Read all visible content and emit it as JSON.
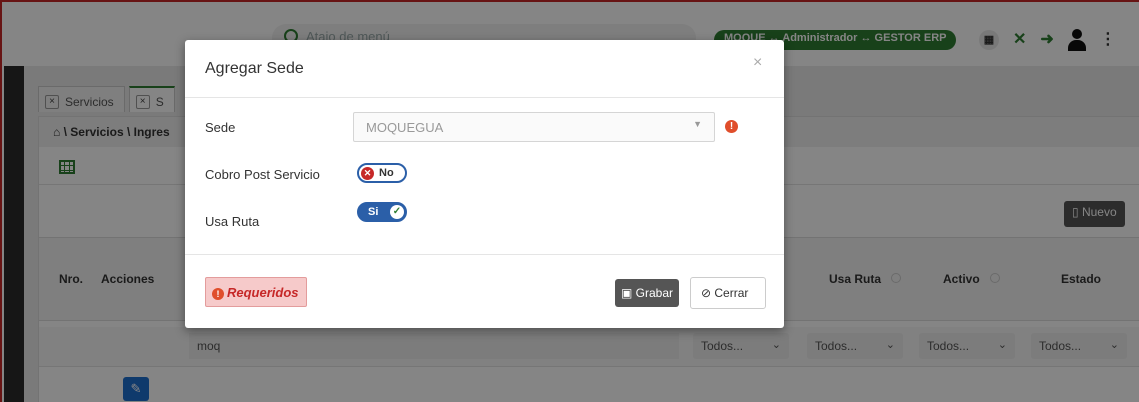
{
  "header": {
    "search_placeholder": "Atajo de menú",
    "user_context": "MOQUE ↔ Administrador ↔ GESTOR ERP"
  },
  "tabs": [
    {
      "label": "Servicios"
    },
    {
      "label": "S"
    }
  ],
  "breadcrumb": "Servicios \\ Ingres",
  "toolbar": {
    "nuevo_label": "Nuevo"
  },
  "grid": {
    "headers": {
      "nro": "Nro.",
      "acciones": "Acciones",
      "usa_ruta": "Usa Ruta",
      "activo": "Activo",
      "estado": "Estado"
    },
    "filters": {
      "search_value": "moq",
      "sel1": "Todos...",
      "sel2": "Todos...",
      "sel3": "Todos...",
      "sel4": "Todos..."
    }
  },
  "modal": {
    "title": "Agregar Sede",
    "close_glyph": "×",
    "fields": {
      "sede_label": "Sede",
      "sede_value": "MOQUEGUA",
      "cobro_label": "Cobro Post Servicio",
      "cobro_toggle_text": "No",
      "cobro_checked": false,
      "usa_ruta_label": "Usa Ruta",
      "usa_ruta_toggle_text": "Si",
      "usa_ruta_checked": true
    },
    "footer": {
      "requeridos_label": "Requeridos",
      "grabar_label": "Grabar",
      "cerrar_label": "Cerrar"
    }
  },
  "colors": {
    "accent_green": "#2e7d32",
    "toggle_blue": "#2b5fa8",
    "warning_red": "#e04e2b"
  }
}
